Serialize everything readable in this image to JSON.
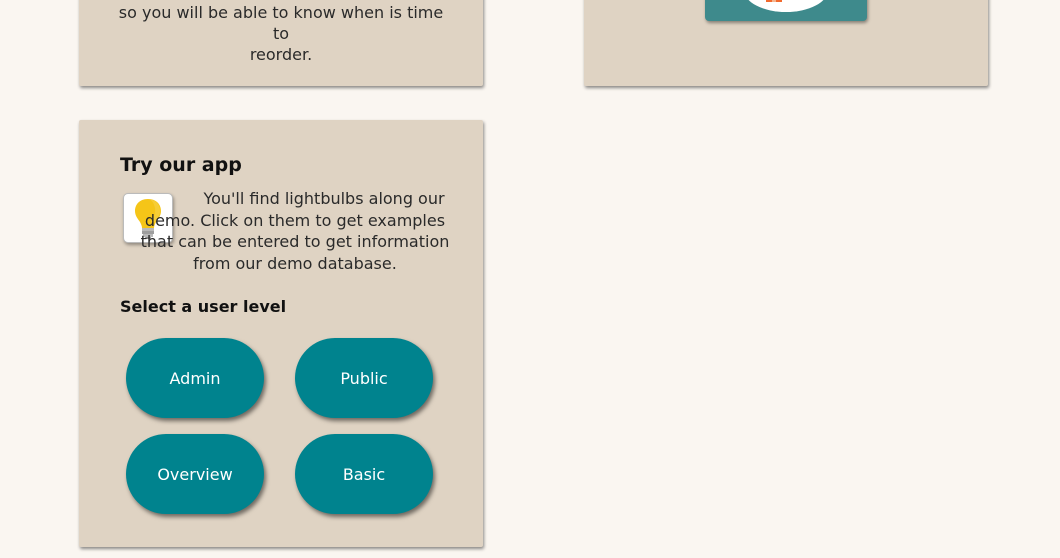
{
  "top_left_card": {
    "text_line1": "so you will be able to know when is time to",
    "text_line2": "reorder."
  },
  "top_right_card": {
    "illustration_icon": "gift-box-illustration"
  },
  "app_card": {
    "title": "Try our app",
    "tip_icon": "lightbulb-icon",
    "tip_text": "You'll find lightbulbs along our demo. Click on them to get examples that can be entered to get information from our demo database.",
    "level_label": "Select a user level",
    "buttons": {
      "admin": "Admin",
      "public": "Public",
      "overview": "Overview",
      "basic": "Basic"
    }
  },
  "colors": {
    "page_background": "#faf6f1",
    "card_background": "#dfd3c3",
    "button_teal": "#00838e",
    "illustration_teal": "#3e8a8c"
  }
}
